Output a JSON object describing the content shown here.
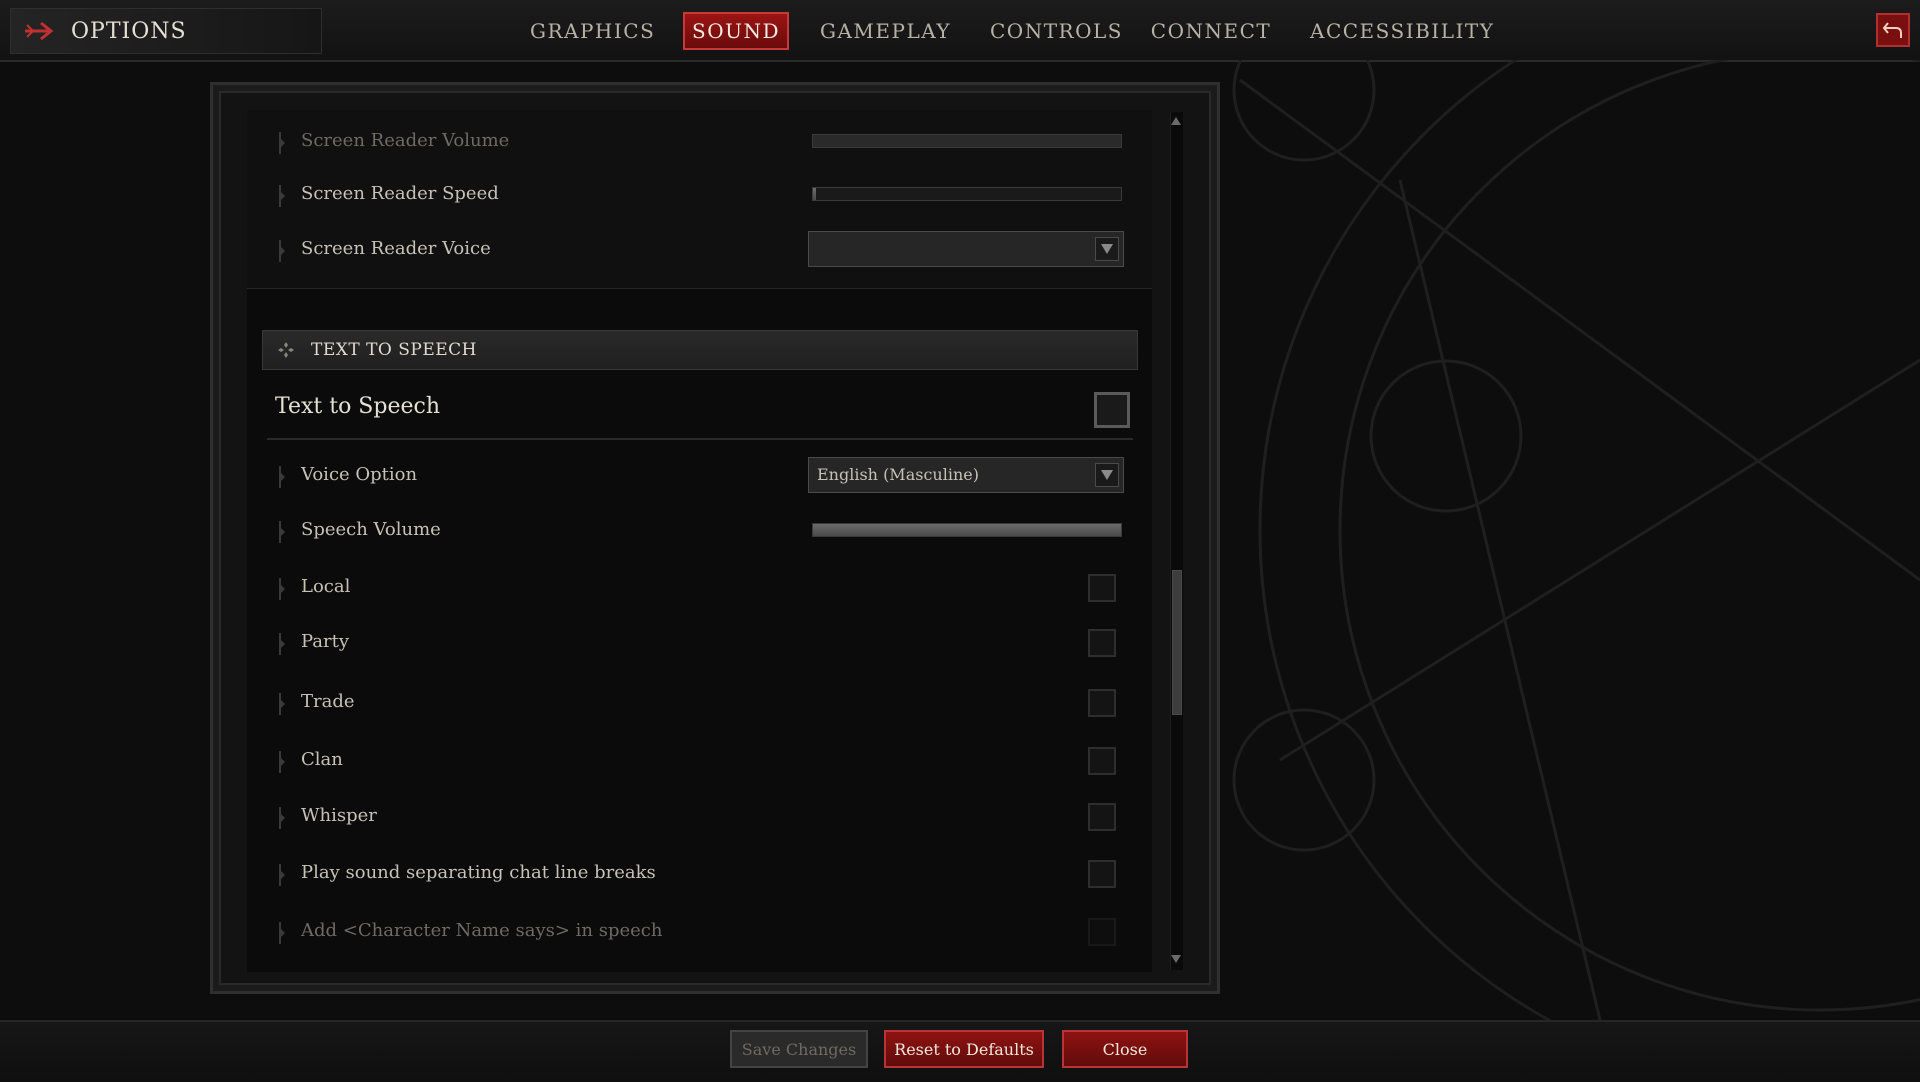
{
  "header": {
    "title": "OPTIONS",
    "tabs": [
      {
        "label": "GRAPHICS",
        "active": false
      },
      {
        "label": "SOUND",
        "active": true
      },
      {
        "label": "GAMEPLAY",
        "active": false
      },
      {
        "label": "CONTROLS",
        "active": false
      },
      {
        "label": "CONNECT",
        "active": false
      },
      {
        "label": "ACCESSIBILITY",
        "active": false
      }
    ],
    "back_icon": "return-arrow-icon"
  },
  "screen_reader": {
    "volume": {
      "label": "Screen Reader Volume",
      "value": "100",
      "fraction": 1.0
    },
    "speed": {
      "label": "Screen Reader Speed",
      "value": "0",
      "fraction": 0.0
    },
    "voice": {
      "label": "Screen Reader Voice",
      "value": ""
    }
  },
  "tts": {
    "section_title": "TEXT TO SPEECH",
    "master_label": "Text to Speech",
    "voice_option": {
      "label": "Voice Option",
      "value": "English (Masculine)"
    },
    "speech_volume": {
      "label": "Speech Volume",
      "value": "100",
      "fraction": 1.0
    },
    "channels": [
      {
        "label": "Local",
        "checked": false
      },
      {
        "label": "Party",
        "checked": false
      },
      {
        "label": "Trade",
        "checked": false
      },
      {
        "label": "Clan",
        "checked": false
      },
      {
        "label": "Whisper",
        "checked": false
      },
      {
        "label": "Play sound separating chat line breaks",
        "checked": false
      },
      {
        "label": "Add <Character Name says> in speech",
        "checked": false
      }
    ]
  },
  "footer": {
    "save_label": "Save Changes",
    "reset_label": "Reset to Defaults",
    "close_label": "Close"
  },
  "colors": {
    "accent_red": "#9c1414",
    "panel": "#0b0b0b",
    "text": "#c7c1b6"
  }
}
